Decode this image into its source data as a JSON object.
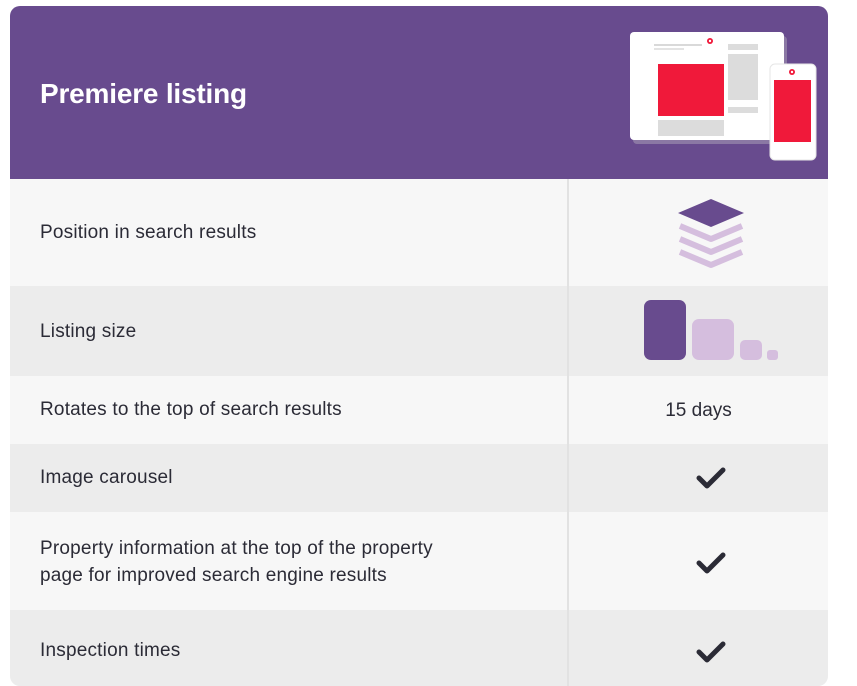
{
  "header": {
    "title": "Premiere listing",
    "icon": "devices-icon",
    "colors": {
      "header_bg": "#684b8e",
      "accent_red": "#f0193a",
      "purple": "#684b8e",
      "lilac": "#d5bede"
    }
  },
  "rows": [
    {
      "label": "Position in search results",
      "icon": "layers-stack-icon"
    },
    {
      "label": "Listing size",
      "icon": "listing-size-icon"
    },
    {
      "label": "Rotates to the top of search results",
      "value": "15 days"
    },
    {
      "label": "Image carousel",
      "icon": "checkmark-icon"
    },
    {
      "label_line1": "Property information at the top of the property",
      "label_line2": "page for improved search engine results",
      "icon": "checkmark-icon"
    },
    {
      "label": "Inspection times",
      "icon": "checkmark-icon"
    }
  ]
}
